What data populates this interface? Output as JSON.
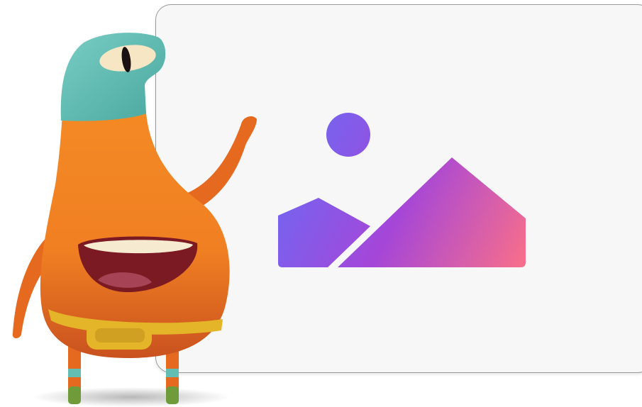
{
  "illustration": {
    "placeholder_icon": "image-placeholder-icon",
    "character": "orange-cyclops-mascot",
    "colors": {
      "card_background": "#f7f7f7",
      "card_border": "#9a9a9a",
      "gradient_start": "#6a6bf5",
      "gradient_mid": "#a546d8",
      "gradient_end": "#fb7088",
      "mascot_body": "#f28424",
      "mascot_head": "#62bdb2",
      "mascot_belt": "#e5b529",
      "mascot_mouth": "#7b1a22"
    }
  }
}
